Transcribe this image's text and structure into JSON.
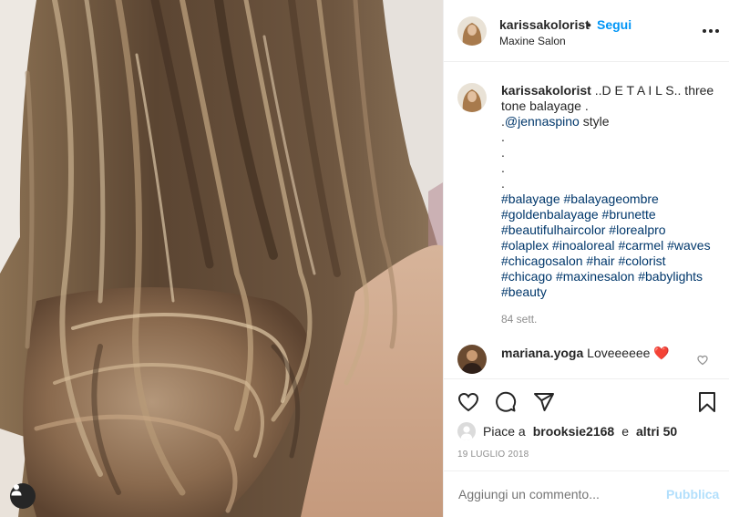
{
  "header": {
    "username": "karissakolorist",
    "separator": "•",
    "follow_label": "Segui",
    "location": "Maxine Salon",
    "more_icon": "more-horizontal-icon"
  },
  "caption": {
    "username": "karissakolorist",
    "lines": [
      "..D E T A I L S.. three tone balayage .",
      ".",
      ".",
      ".",
      ".",
      "."
    ],
    "mention": "@jennaspino",
    "mention_suffix": " style",
    "hashtags": [
      "#balayage",
      "#balayageombre",
      "#brunette",
      "#goldenbalayage",
      "#beautifulhaircolor",
      "#lorealpro",
      "#olaplex",
      "#inoaloreal",
      "#carmel",
      "#waves",
      "#chicagosalon",
      "#hair",
      "#colorist",
      "#chicago",
      "#maxinesalon",
      "#babylights",
      "#beauty"
    ],
    "time": "84 sett."
  },
  "comment": {
    "username": "mariana.yoga",
    "text": "Loveeeeee",
    "emoji": "❤️"
  },
  "actions": {
    "like_icon": "heart-icon",
    "comment_icon": "comment-icon",
    "share_icon": "paper-plane-icon",
    "save_icon": "bookmark-icon"
  },
  "likes": {
    "prefix": "Piace a",
    "user": "brooksie2168",
    "conjunction": "e",
    "others": "altri 50"
  },
  "date": "19 LUGLIO 2018",
  "add_comment": {
    "placeholder": "Aggiungi un commento...",
    "post_label": "Pubblica"
  },
  "colors": {
    "link_blue": "#0095f6",
    "hashtag_blue": "#00376b",
    "muted": "#8e8e8e",
    "heart_red": "#ed4956"
  }
}
